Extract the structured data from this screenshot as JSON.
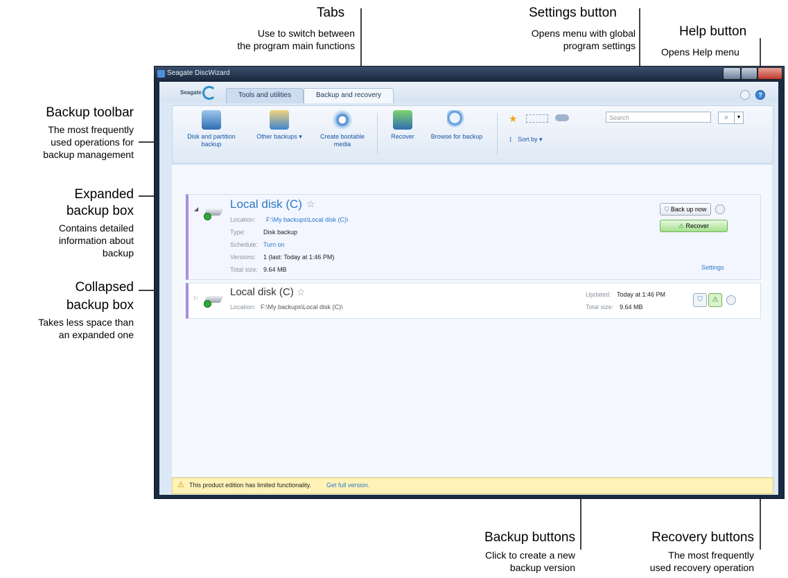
{
  "annotations": {
    "tabs": {
      "title": "Tabs",
      "desc1": "Use to switch between",
      "desc2": "the program main functions"
    },
    "settings": {
      "title": "Settings button",
      "desc1": "Opens menu with global",
      "desc2": "program settings"
    },
    "help": {
      "title": "Help button",
      "desc1": "Opens Help menu"
    },
    "toolbar": {
      "title": "Backup toolbar",
      "desc1": "The most frequently",
      "desc2": "used operations for",
      "desc3": "backup management"
    },
    "expanded": {
      "title1": "Expanded",
      "title2": "backup box",
      "desc1": "Contains detailed",
      "desc2": "information about",
      "desc3": "backup"
    },
    "collapsed": {
      "title1": "Collapsed",
      "title2": "backup box",
      "desc1": "Takes less space than",
      "desc2": "an expanded one"
    },
    "backup_buttons": {
      "title": "Backup buttons",
      "desc1": "Click to create a new",
      "desc2": "backup version"
    },
    "recovery_buttons": {
      "title": "Recovery buttons",
      "desc1": "The most frequently",
      "desc2": "used recovery operation"
    }
  },
  "window": {
    "title": "Seagate DiscWizard"
  },
  "logo": {
    "text": "Seagate"
  },
  "tabs": [
    {
      "label": "Tools and utilities"
    },
    {
      "label": "Backup and recovery"
    }
  ],
  "toolbar": {
    "disk_backup": {
      "line1": "Disk and partition",
      "line2": "backup"
    },
    "other_backups": "Other backups ▾",
    "bootable": {
      "line1": "Create bootable",
      "line2": "media"
    },
    "recover": "Recover",
    "browse": "Browse for backup",
    "sort_by": "Sort by ▾",
    "search_placeholder": "Search"
  },
  "expanded_box": {
    "title": "Local disk (C)",
    "location_label": "Location:",
    "location_value": "F:\\My backups\\Local disk (C)\\",
    "type_label": "Type:",
    "type_value": "Disk backup",
    "schedule_label": "Schedule:",
    "schedule_value": "Turn on",
    "versions_label": "Versions:",
    "versions_value": "1 (last: Today at 1:46 PM)",
    "size_label": "Total size:",
    "size_value": "9.64 MB",
    "back_up_now": "Back up now",
    "recover": "Recover",
    "settings_link": "Settings"
  },
  "collapsed_box": {
    "title": "Local disk (C)",
    "location_label": "Location:",
    "location_value": "F:\\My backups\\Local disk (C)\\",
    "updated_label": "Updated:",
    "updated_value": "Today at 1:46 PM",
    "size_label": "Total size:",
    "size_value": "9.64 MB"
  },
  "statusbar": {
    "message": "This product edition has limited functionality.",
    "link": "Get full version."
  },
  "colors": {
    "accent": "#2a78c6",
    "box_border": "#a98ee0",
    "recover_green": "#6fcf62"
  }
}
